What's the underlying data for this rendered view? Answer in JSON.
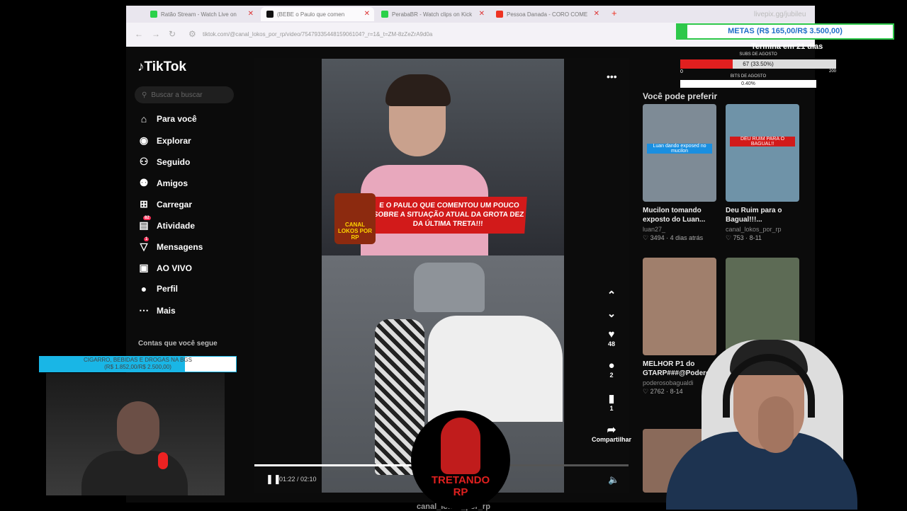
{
  "browser": {
    "tabs": [
      {
        "title": "Ratão Stream - Watch Live on",
        "favicon": "kick-icon"
      },
      {
        "title": "(BEBE o Paulo que comen",
        "favicon": "tiktok-icon"
      },
      {
        "title": "PerabaBR - Watch clips on Kick",
        "favicon": "kick-icon"
      },
      {
        "title": "Pessoa Danada - CORO COME",
        "favicon": "youtube-icon"
      }
    ],
    "url": "tiktok.com/@canal_lokos_por_rp/video/7547933544815906104?_r=1&_t=ZM-8zZeZrA9d0a"
  },
  "tiktok": {
    "logo": "TikTok",
    "search_placeholder": "Buscar a buscar",
    "nav": [
      {
        "label": "Para você",
        "icon": "home-icon"
      },
      {
        "label": "Explorar",
        "icon": "compass-icon"
      },
      {
        "label": "Seguido",
        "icon": "following-icon"
      },
      {
        "label": "Amigos",
        "icon": "friends-icon"
      },
      {
        "label": "Carregar",
        "icon": "upload-icon"
      },
      {
        "label": "Atividade",
        "icon": "activity-icon",
        "badge": "82"
      },
      {
        "label": "Mensagens",
        "icon": "messages-icon",
        "badge": "1"
      },
      {
        "label": "AO VIVO",
        "icon": "live-icon"
      },
      {
        "label": "Perfil",
        "icon": "profile-icon"
      },
      {
        "label": "Mais",
        "icon": "more-icon"
      }
    ],
    "following_title": "Contas que você segue",
    "video": {
      "banner_text": "E O PAULO QUE COMENTOU UM POUCO SOBRE A SITUAÇÃO ATUAL DA GROTA DEZ DA ÚLTIMA TRETA!!!",
      "channel_logo": "CANAL LOKOS POR RP",
      "time": "01:22 / 02:10",
      "progress": 0.42,
      "likes": "48",
      "comments": "2",
      "saves": "1",
      "share_label": "Compartilhar",
      "author": "canal_lokos_por_rp"
    },
    "recommended_title": "Você pode preferir",
    "recommended": [
      {
        "title": "Mucilon tomando exposto do Luan...",
        "author": "luan27_",
        "stats": "♡ 3494 · 4 dias atrás",
        "thumb_color": "#7e8b96",
        "thumb_text": "Luan dando exposed no mucilon"
      },
      {
        "title": "Deu Ruim para o Bagual!!!...",
        "author": "canal_lokos_por_rp",
        "stats": "♡ 753 · 8-11",
        "thumb_color": "#6f93a8",
        "thumb_text": "DEU RUIM PARA O BAGUAL!!"
      },
      {
        "title": "MELHOR P1 do GTARP###@Podero...",
        "author": "poderosobagualdi",
        "stats": "♡ 2762 · 8-14",
        "thumb_color": "#a07f6c",
        "thumb_text": ""
      },
      {
        "title": "",
        "author": "",
        "stats": "",
        "thumb_color": "#5d6b55",
        "thumb_text": ""
      }
    ]
  },
  "overlay": {
    "streamer_link": "livepix.gg/jubileu",
    "metas": "METAS (R$ 165,00/R$ 3.500,00)",
    "metas_progress": 0.047,
    "termina": "Termina em 21 dias",
    "subs_label": "SUBS DE AGOSTO",
    "subs_text": "67 (33.50%)",
    "subs_min": "0",
    "subs_max": "200",
    "subs_progress": 0.335,
    "bits_label": "BITS DE AGOSTO",
    "bits_text": "0.40%",
    "cigar_text": "CIGARRO, BEBIDAS E DROGAS NA BGS",
    "cigar_value": "(R$ 1.852,00/R$ 2.500,00)",
    "cigar_progress": 0.74,
    "tretando_line1": "TRETANDO",
    "tretando_line2": "RP"
  },
  "colors": {
    "metas_green": "#2ec84a",
    "subs_red": "#e21f1f",
    "cigar_blue": "#19b6e6",
    "tiktok_red": "#fe2c55"
  }
}
